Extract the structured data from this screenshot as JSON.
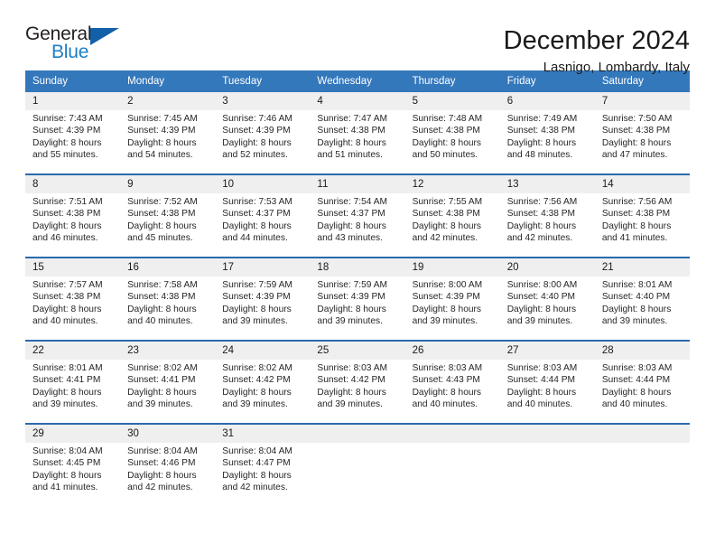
{
  "logo": {
    "primary_text": "General",
    "secondary_text": "Blue",
    "triangle_color": "#1260a8",
    "blue_text_color": "#1c7fc4"
  },
  "header": {
    "title": "December 2024",
    "subtitle": "Lasnigo, Lombardy, Italy"
  },
  "theme": {
    "header_bar_color": "#3478bc",
    "week_divider_color": "#2a6aad",
    "daynum_band_color": "#efefef"
  },
  "weekdays": [
    "Sunday",
    "Monday",
    "Tuesday",
    "Wednesday",
    "Thursday",
    "Friday",
    "Saturday"
  ],
  "weeks": [
    [
      {
        "day": "1",
        "sunrise": "Sunrise: 7:43 AM",
        "sunset": "Sunset: 4:39 PM",
        "daylight1": "Daylight: 8 hours",
        "daylight2": "and 55 minutes."
      },
      {
        "day": "2",
        "sunrise": "Sunrise: 7:45 AM",
        "sunset": "Sunset: 4:39 PM",
        "daylight1": "Daylight: 8 hours",
        "daylight2": "and 54 minutes."
      },
      {
        "day": "3",
        "sunrise": "Sunrise: 7:46 AM",
        "sunset": "Sunset: 4:39 PM",
        "daylight1": "Daylight: 8 hours",
        "daylight2": "and 52 minutes."
      },
      {
        "day": "4",
        "sunrise": "Sunrise: 7:47 AM",
        "sunset": "Sunset: 4:38 PM",
        "daylight1": "Daylight: 8 hours",
        "daylight2": "and 51 minutes."
      },
      {
        "day": "5",
        "sunrise": "Sunrise: 7:48 AM",
        "sunset": "Sunset: 4:38 PM",
        "daylight1": "Daylight: 8 hours",
        "daylight2": "and 50 minutes."
      },
      {
        "day": "6",
        "sunrise": "Sunrise: 7:49 AM",
        "sunset": "Sunset: 4:38 PM",
        "daylight1": "Daylight: 8 hours",
        "daylight2": "and 48 minutes."
      },
      {
        "day": "7",
        "sunrise": "Sunrise: 7:50 AM",
        "sunset": "Sunset: 4:38 PM",
        "daylight1": "Daylight: 8 hours",
        "daylight2": "and 47 minutes."
      }
    ],
    [
      {
        "day": "8",
        "sunrise": "Sunrise: 7:51 AM",
        "sunset": "Sunset: 4:38 PM",
        "daylight1": "Daylight: 8 hours",
        "daylight2": "and 46 minutes."
      },
      {
        "day": "9",
        "sunrise": "Sunrise: 7:52 AM",
        "sunset": "Sunset: 4:38 PM",
        "daylight1": "Daylight: 8 hours",
        "daylight2": "and 45 minutes."
      },
      {
        "day": "10",
        "sunrise": "Sunrise: 7:53 AM",
        "sunset": "Sunset: 4:37 PM",
        "daylight1": "Daylight: 8 hours",
        "daylight2": "and 44 minutes."
      },
      {
        "day": "11",
        "sunrise": "Sunrise: 7:54 AM",
        "sunset": "Sunset: 4:37 PM",
        "daylight1": "Daylight: 8 hours",
        "daylight2": "and 43 minutes."
      },
      {
        "day": "12",
        "sunrise": "Sunrise: 7:55 AM",
        "sunset": "Sunset: 4:38 PM",
        "daylight1": "Daylight: 8 hours",
        "daylight2": "and 42 minutes."
      },
      {
        "day": "13",
        "sunrise": "Sunrise: 7:56 AM",
        "sunset": "Sunset: 4:38 PM",
        "daylight1": "Daylight: 8 hours",
        "daylight2": "and 42 minutes."
      },
      {
        "day": "14",
        "sunrise": "Sunrise: 7:56 AM",
        "sunset": "Sunset: 4:38 PM",
        "daylight1": "Daylight: 8 hours",
        "daylight2": "and 41 minutes."
      }
    ],
    [
      {
        "day": "15",
        "sunrise": "Sunrise: 7:57 AM",
        "sunset": "Sunset: 4:38 PM",
        "daylight1": "Daylight: 8 hours",
        "daylight2": "and 40 minutes."
      },
      {
        "day": "16",
        "sunrise": "Sunrise: 7:58 AM",
        "sunset": "Sunset: 4:38 PM",
        "daylight1": "Daylight: 8 hours",
        "daylight2": "and 40 minutes."
      },
      {
        "day": "17",
        "sunrise": "Sunrise: 7:59 AM",
        "sunset": "Sunset: 4:39 PM",
        "daylight1": "Daylight: 8 hours",
        "daylight2": "and 39 minutes."
      },
      {
        "day": "18",
        "sunrise": "Sunrise: 7:59 AM",
        "sunset": "Sunset: 4:39 PM",
        "daylight1": "Daylight: 8 hours",
        "daylight2": "and 39 minutes."
      },
      {
        "day": "19",
        "sunrise": "Sunrise: 8:00 AM",
        "sunset": "Sunset: 4:39 PM",
        "daylight1": "Daylight: 8 hours",
        "daylight2": "and 39 minutes."
      },
      {
        "day": "20",
        "sunrise": "Sunrise: 8:00 AM",
        "sunset": "Sunset: 4:40 PM",
        "daylight1": "Daylight: 8 hours",
        "daylight2": "and 39 minutes."
      },
      {
        "day": "21",
        "sunrise": "Sunrise: 8:01 AM",
        "sunset": "Sunset: 4:40 PM",
        "daylight1": "Daylight: 8 hours",
        "daylight2": "and 39 minutes."
      }
    ],
    [
      {
        "day": "22",
        "sunrise": "Sunrise: 8:01 AM",
        "sunset": "Sunset: 4:41 PM",
        "daylight1": "Daylight: 8 hours",
        "daylight2": "and 39 minutes."
      },
      {
        "day": "23",
        "sunrise": "Sunrise: 8:02 AM",
        "sunset": "Sunset: 4:41 PM",
        "daylight1": "Daylight: 8 hours",
        "daylight2": "and 39 minutes."
      },
      {
        "day": "24",
        "sunrise": "Sunrise: 8:02 AM",
        "sunset": "Sunset: 4:42 PM",
        "daylight1": "Daylight: 8 hours",
        "daylight2": "and 39 minutes."
      },
      {
        "day": "25",
        "sunrise": "Sunrise: 8:03 AM",
        "sunset": "Sunset: 4:42 PM",
        "daylight1": "Daylight: 8 hours",
        "daylight2": "and 39 minutes."
      },
      {
        "day": "26",
        "sunrise": "Sunrise: 8:03 AM",
        "sunset": "Sunset: 4:43 PM",
        "daylight1": "Daylight: 8 hours",
        "daylight2": "and 40 minutes."
      },
      {
        "day": "27",
        "sunrise": "Sunrise: 8:03 AM",
        "sunset": "Sunset: 4:44 PM",
        "daylight1": "Daylight: 8 hours",
        "daylight2": "and 40 minutes."
      },
      {
        "day": "28",
        "sunrise": "Sunrise: 8:03 AM",
        "sunset": "Sunset: 4:44 PM",
        "daylight1": "Daylight: 8 hours",
        "daylight2": "and 40 minutes."
      }
    ],
    [
      {
        "day": "29",
        "sunrise": "Sunrise: 8:04 AM",
        "sunset": "Sunset: 4:45 PM",
        "daylight1": "Daylight: 8 hours",
        "daylight2": "and 41 minutes."
      },
      {
        "day": "30",
        "sunrise": "Sunrise: 8:04 AM",
        "sunset": "Sunset: 4:46 PM",
        "daylight1": "Daylight: 8 hours",
        "daylight2": "and 42 minutes."
      },
      {
        "day": "31",
        "sunrise": "Sunrise: 8:04 AM",
        "sunset": "Sunset: 4:47 PM",
        "daylight1": "Daylight: 8 hours",
        "daylight2": "and 42 minutes."
      },
      {
        "day": "",
        "sunrise": "",
        "sunset": "",
        "daylight1": "",
        "daylight2": ""
      },
      {
        "day": "",
        "sunrise": "",
        "sunset": "",
        "daylight1": "",
        "daylight2": ""
      },
      {
        "day": "",
        "sunrise": "",
        "sunset": "",
        "daylight1": "",
        "daylight2": ""
      },
      {
        "day": "",
        "sunrise": "",
        "sunset": "",
        "daylight1": "",
        "daylight2": ""
      }
    ]
  ]
}
